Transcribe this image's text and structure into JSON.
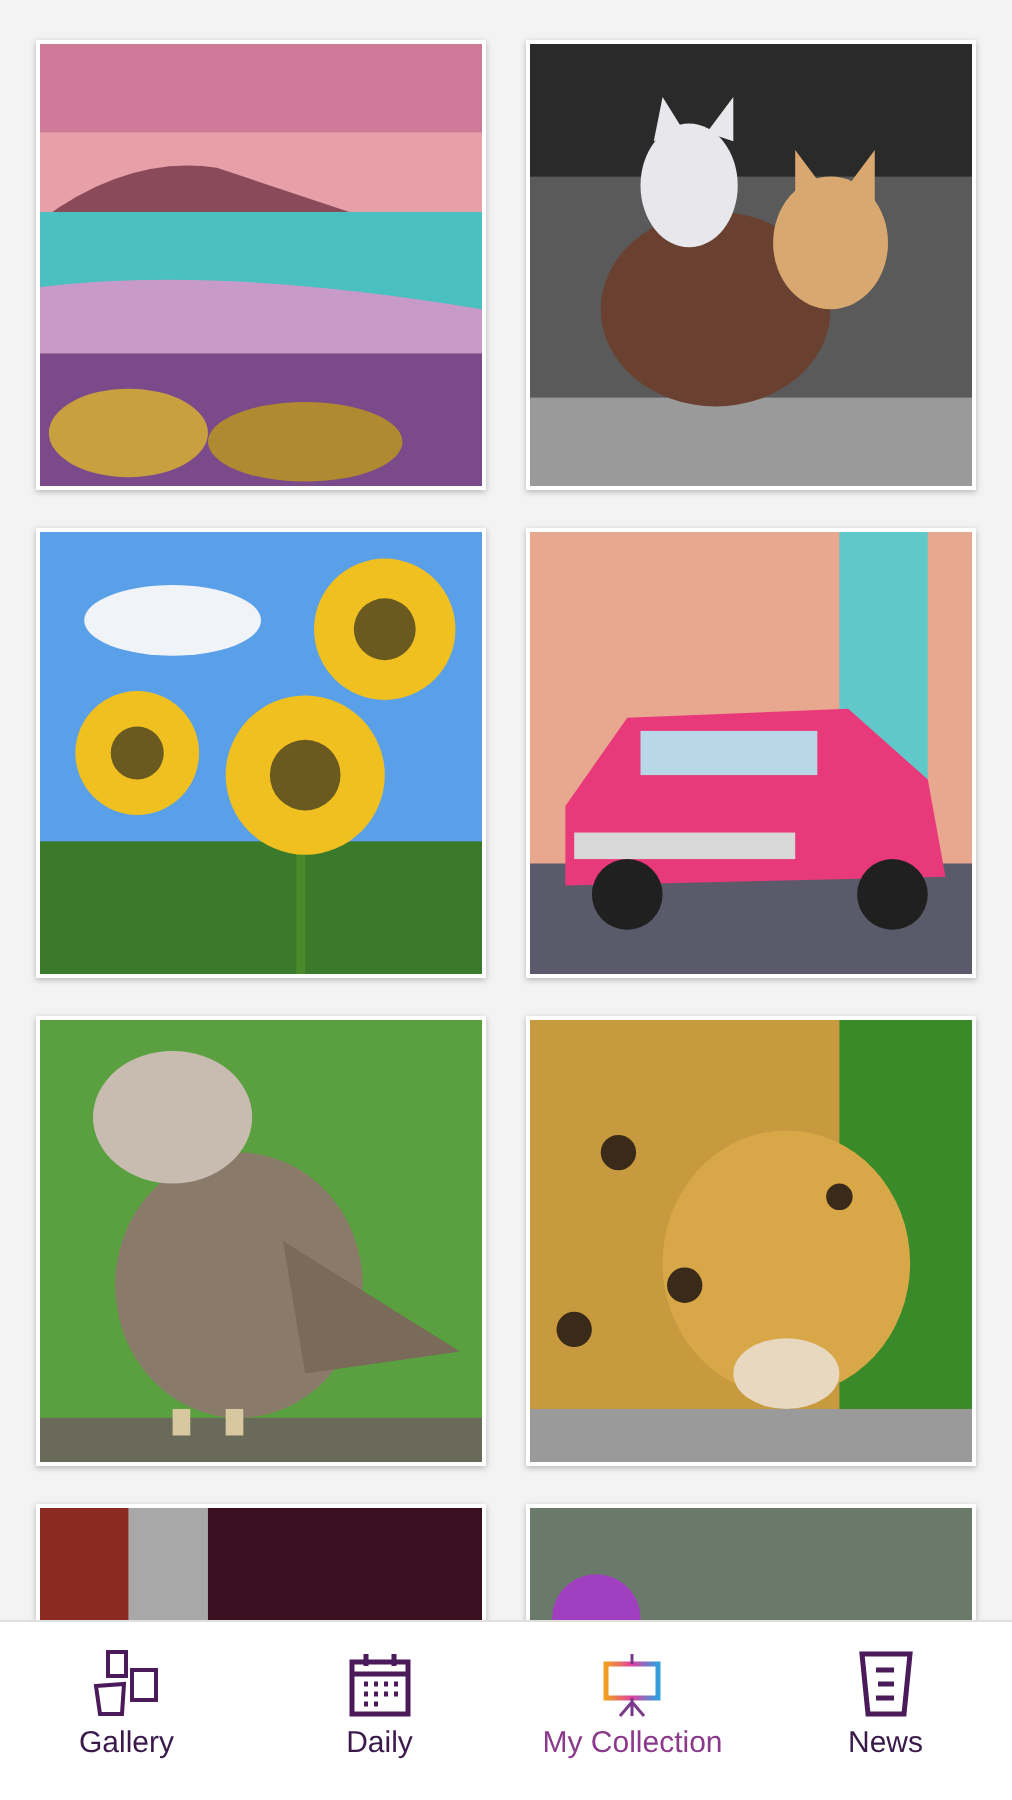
{
  "nav": [
    {
      "label": "Gallery",
      "kind": "gallery",
      "selected": false
    },
    {
      "label": "Daily",
      "kind": "daily",
      "selected": false
    },
    {
      "label": "My Collection",
      "kind": "collection",
      "selected": true
    },
    {
      "label": "News",
      "kind": "news",
      "selected": false
    }
  ]
}
